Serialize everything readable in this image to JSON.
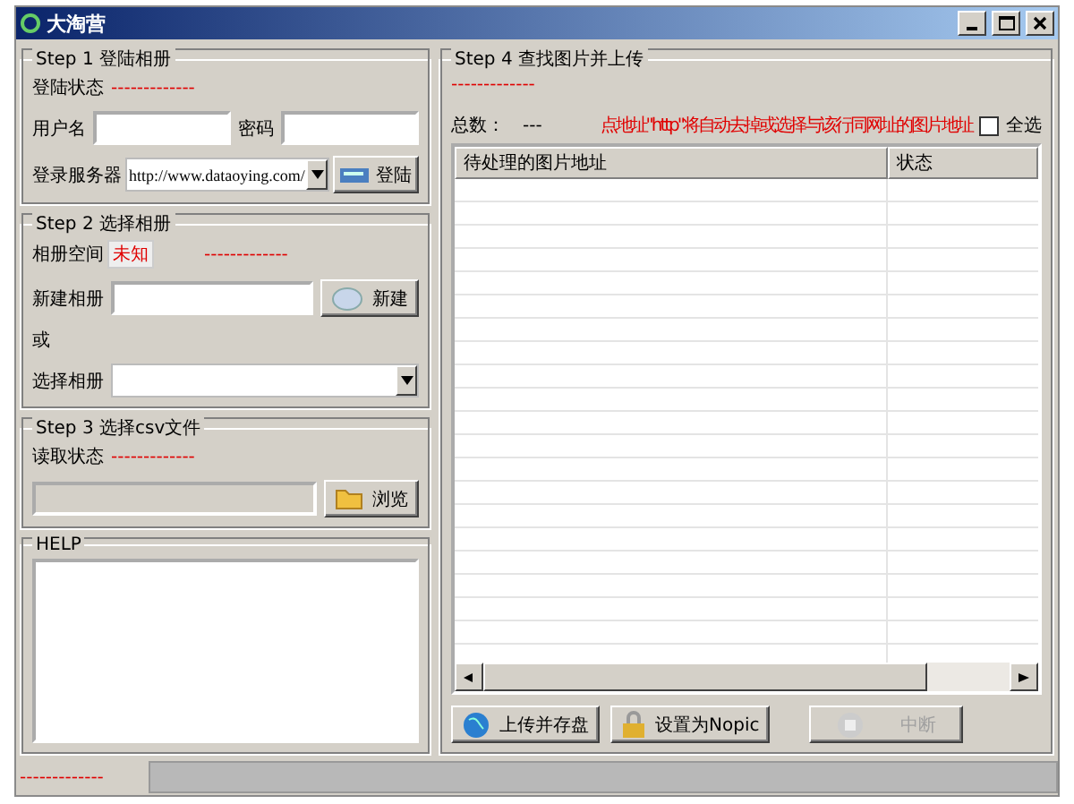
{
  "window": {
    "title": "大淘营"
  },
  "step1": {
    "title": "Step 1 登陆相册",
    "status_label": "登陆状态",
    "status_value": "-------------",
    "username_label": "用户名",
    "password_label": "密码",
    "server_label": "登录服务器",
    "server_value": "http://www.dataoying.com/",
    "login_button": "登陆"
  },
  "step2": {
    "title": "Step 2 选择相册",
    "space_label": "相册空间",
    "space_value": "未知",
    "space_status": "-------------",
    "new_label": "新建相册",
    "new_button": "新建",
    "or_text": "或",
    "select_label": "选择相册"
  },
  "step3": {
    "title": "Step 3 选择csv文件",
    "read_label": "读取状态",
    "read_value": "-------------",
    "browse_button": "浏览"
  },
  "help": {
    "title": "HELP"
  },
  "step4": {
    "title": "Step 4 查找图片并上传",
    "status": "-------------",
    "total_label": "总数：",
    "total_value": "---",
    "hint": "点地址\"http\"将自动去掉或选择与该行同网址的图片地址",
    "select_all": {
      "label": "全选",
      "checked": false
    },
    "columns": [
      "待处理的图片地址",
      "状态"
    ],
    "buttons": [
      {
        "kind": "upload",
        "label": "上传并存盘",
        "disabled": false
      },
      {
        "kind": "lock",
        "label": "设置为Nopic",
        "disabled": false
      },
      {
        "kind": "stop",
        "label": "中断",
        "disabled": true
      }
    ]
  },
  "status_bar": {
    "text": "-------------"
  }
}
